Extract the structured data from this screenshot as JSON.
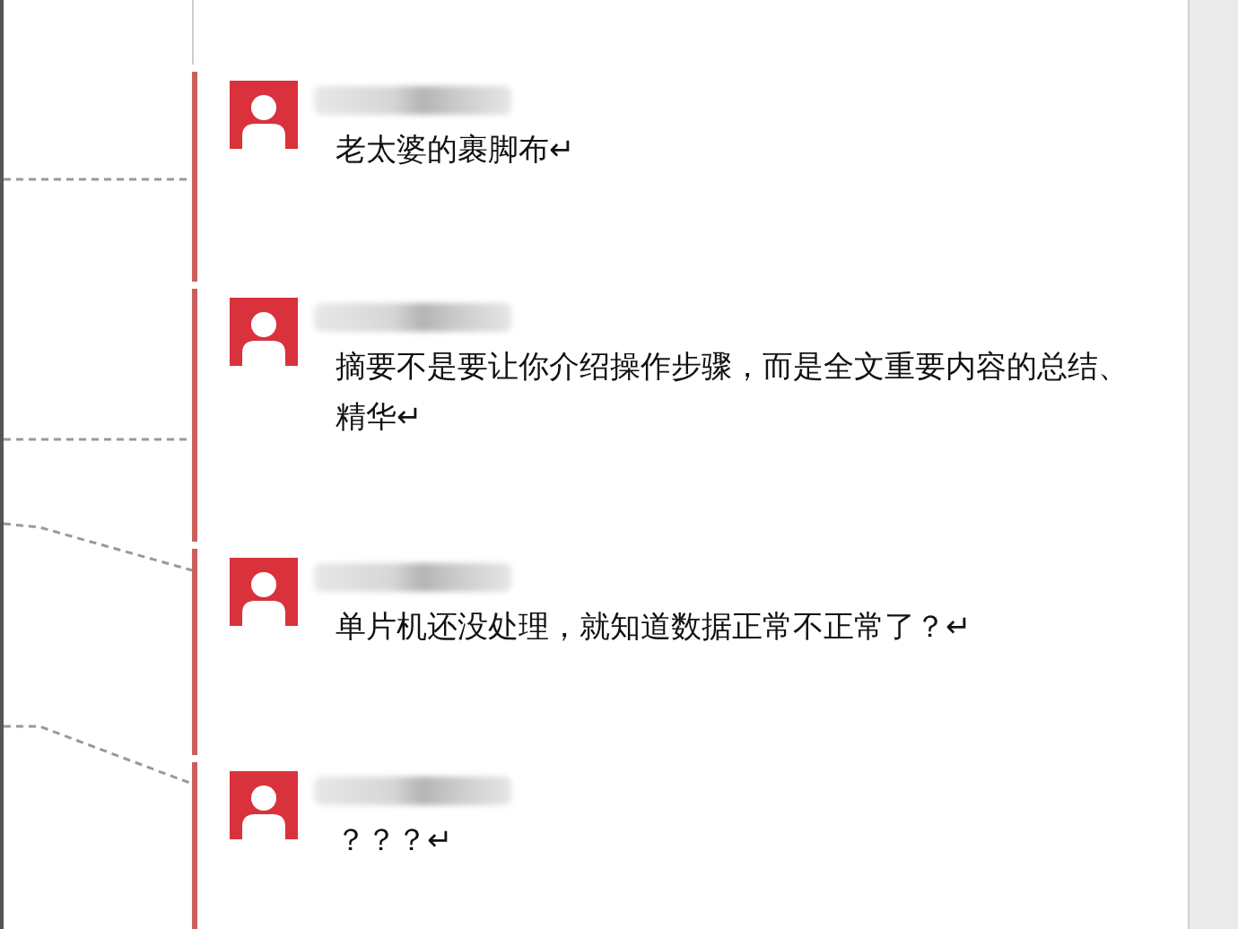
{
  "comments": [
    {
      "text": "老太婆的裹脚布↵"
    },
    {
      "text": "摘要不是要让你介绍操作步骤，而是全文重要内容的总结、精华↵"
    },
    {
      "text": "单片机还没处理，就知道数据正常不正常了？↵"
    },
    {
      "text": "？？？↵"
    }
  ]
}
